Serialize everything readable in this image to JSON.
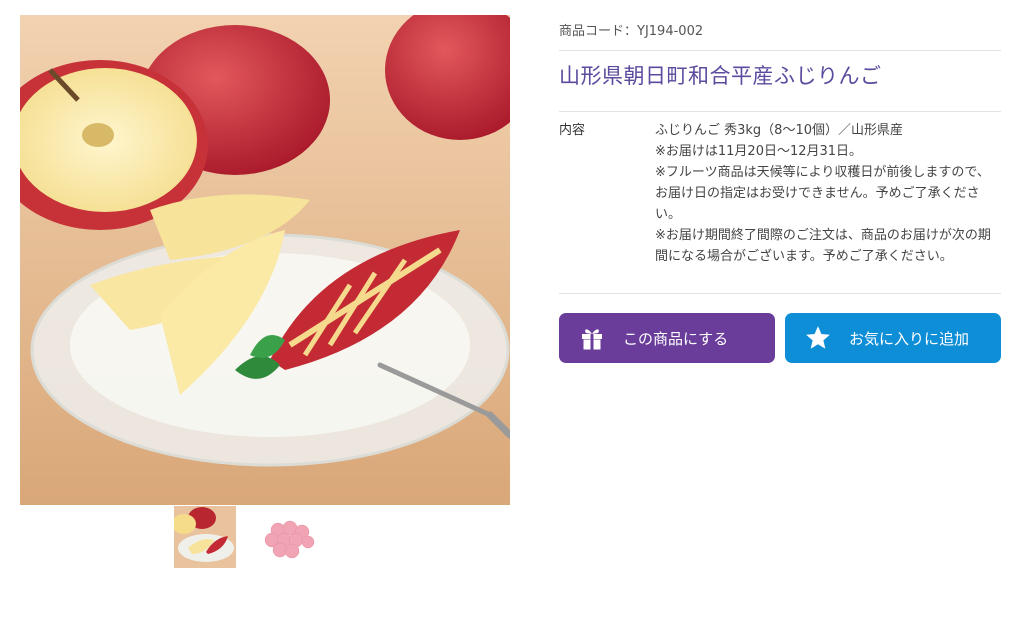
{
  "gallery": {
    "main_image_alt": "りんごの写真",
    "thumbnails": [
      {
        "icon": "apple-photo-thumb"
      },
      {
        "icon": "pink-balls-thumb"
      }
    ]
  },
  "product": {
    "code_label": "商品コード：",
    "code_value": "YJ194-002",
    "title": "山形県朝日町和合平産ふじりんご",
    "detail_label": "内容",
    "detail_lines": [
      "ふじりんご 秀3kg（8～10個）／山形県産",
      "※お届けは11月20日～12月31日。",
      "※フルーツ商品は天候等により収穫日が前後しますので、お届け日の指定はお受けできません。予めご了承ください。",
      "※お届け期間終了間際のご注文は、商品のお届けが次の期間になる場合がございます。予めご了承ください。"
    ]
  },
  "buttons": {
    "select_label": "この商品にする",
    "select_icon": "gift-icon",
    "favorite_label": "お気に入りに追加",
    "favorite_icon": "star-icon"
  },
  "colors": {
    "title": "#5c4a9e",
    "select_button": "#6a3d9a",
    "favorite_button": "#0f8ed8"
  }
}
